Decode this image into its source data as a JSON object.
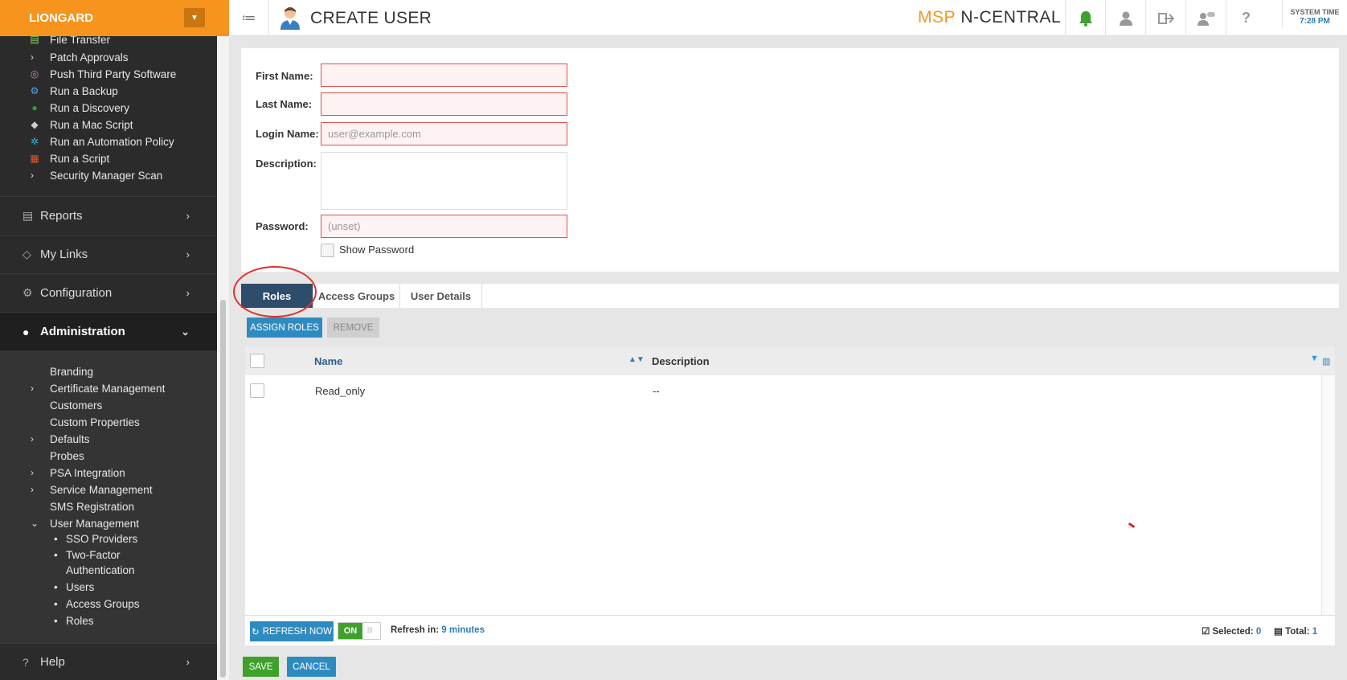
{
  "brand": {
    "name": "LIONGARD"
  },
  "sidebar": {
    "tools": [
      {
        "label": "File Transfer",
        "icon": "file-transfer-icon"
      },
      {
        "label": "Patch Approvals",
        "icon": "chevron-right-icon"
      },
      {
        "label": "Push Third Party Software",
        "icon": "push-software-icon"
      },
      {
        "label": "Run a Backup",
        "icon": "gear-icon"
      },
      {
        "label": "Run a Discovery",
        "icon": "globe-icon"
      },
      {
        "label": "Run a Mac Script",
        "icon": "apple-icon"
      },
      {
        "label": "Run an Automation Policy",
        "icon": "automation-icon"
      },
      {
        "label": "Run a Script",
        "icon": "windows-icon"
      },
      {
        "label": "Security Manager Scan",
        "icon": "chevron-right-icon"
      }
    ],
    "sections": {
      "reports": "Reports",
      "my_links": "My Links",
      "configuration": "Configuration",
      "administration": "Administration",
      "help": "Help"
    },
    "admin_items": [
      "Branding",
      "Certificate Management",
      "Customers",
      "Custom Properties",
      "Defaults",
      "Probes",
      "PSA Integration",
      "Service Management",
      "SMS Registration",
      "User Management"
    ],
    "user_mgmt_items": [
      "SSO Providers",
      "Two-Factor Authentication",
      "Users",
      "Access Groups",
      "Roles"
    ]
  },
  "header": {
    "title": "CREATE USER",
    "logo_msp": "MSP",
    "logo_nc": "N-CENTRAL",
    "system_time_label": "SYSTEM TIME",
    "system_time_value": "7:28 PM"
  },
  "form": {
    "first_name_label": "First Name:",
    "last_name_label": "Last Name:",
    "login_name_label": "Login Name:",
    "login_name_placeholder": "user@example.com",
    "description_label": "Description:",
    "password_label": "Password:",
    "password_placeholder": "(unset)",
    "show_password_label": "Show Password"
  },
  "tabs": [
    "Roles",
    "Access Groups",
    "User Details"
  ],
  "actions": {
    "assign_roles": "ASSIGN ROLES",
    "remove": "REMOVE"
  },
  "grid": {
    "columns": [
      "Name",
      "Description"
    ],
    "rows": [
      {
        "name": "Read_only",
        "description": "--"
      }
    ]
  },
  "footer": {
    "refresh_now": "REFRESH NOW",
    "toggle_on": "ON",
    "refresh_in_label": "Refresh in:",
    "refresh_in_value": "9 minutes",
    "selected_label": "Selected:",
    "selected_value": "0",
    "total_label": "Total:",
    "total_value": "1"
  },
  "buttons": {
    "save": "SAVE",
    "cancel": "CANCEL"
  },
  "colors": {
    "brand": "#f7941d",
    "accent": "#2e8bc0",
    "success": "#3fa12c",
    "active_tab": "#2e4d6b",
    "error": "#d9534f"
  }
}
